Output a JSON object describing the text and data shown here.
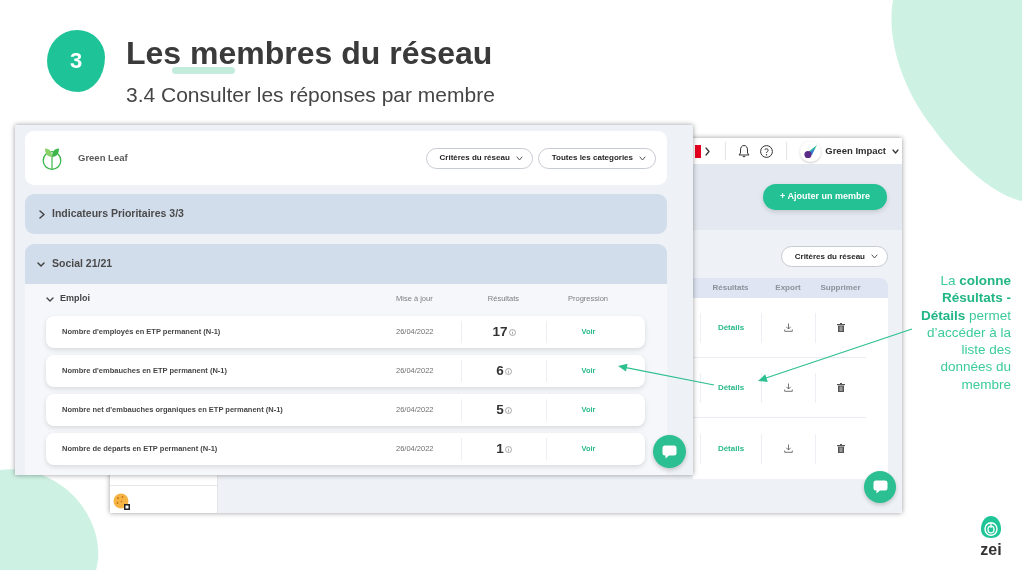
{
  "slide": {
    "step": "3",
    "title": "Les membres du réseau",
    "subtitle": "3.4 Consulter les réponses par membre"
  },
  "member_screen": {
    "member": "Green Leaf",
    "filters": [
      "Critères du réseau",
      "Toutes les categories"
    ],
    "sections": [
      {
        "title": "Indicateurs Prioritaires 3/3",
        "expanded": false
      },
      {
        "title": "Social 21/21",
        "expanded": true,
        "groups": [
          {
            "title": "Emploi",
            "expanded": true,
            "columns": [
              "Mise à jour",
              "Résultats",
              "Progression"
            ],
            "rows": [
              {
                "label": "Nombre d'employés en ETP permanent (N-1)",
                "date": "26/04/2022",
                "result": "17",
                "action": "Voir"
              },
              {
                "label": "Nombre d'embauches en ETP permanent (N-1)",
                "date": "26/04/2022",
                "result": "6",
                "action": "Voir"
              },
              {
                "label": "Nombre net d'embauches organiques en ETP permanent (N-1)",
                "date": "26/04/2022",
                "result": "5",
                "action": "Voir"
              },
              {
                "label": "Nombre de départs en ETP permanent (N-1)",
                "date": "26/04/2022",
                "result": "1",
                "action": "Voir"
              }
            ]
          }
        ]
      }
    ]
  },
  "network_screen": {
    "topbar": {
      "account": "Green Impact"
    },
    "add_button": "+ Ajouter un membre",
    "filter": "Critères du réseau",
    "table": {
      "columns": [
        "Résultats",
        "Export",
        "Supprimer"
      ],
      "rows": [
        {
          "results": "Détails"
        },
        {
          "results": "Détails"
        },
        {
          "results": "Détails"
        }
      ]
    }
  },
  "annotation": {
    "text": "La **colonne Résultats - Détails** permet d’accéder à la liste des données du membre"
  },
  "brand": {
    "logo_text": "zei"
  }
}
